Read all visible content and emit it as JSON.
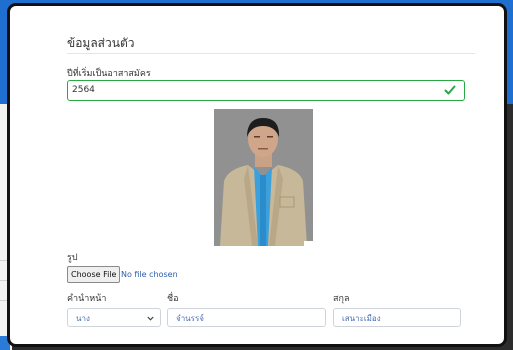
{
  "colors": {
    "accent": "#1f6fd0",
    "valid": "#28a745",
    "link": "#2a5db0"
  },
  "modal": {
    "title": "ข้อมูลส่วนตัว",
    "year_label": "ปีที่เริ่มเป็นอาสาสมัคร",
    "year_value": "2564",
    "photo_label": "รูป",
    "file_button": "Choose File",
    "file_status": "No file chosen",
    "prefix_label": "คำนำหน้า",
    "prefix_value": "นาง",
    "first_name_label": "ชื่อ",
    "first_name_value": "จำนรรจ์",
    "last_name_label": "สกุล",
    "last_name_value": "เสนาะเมือง"
  },
  "icons": {
    "valid": "check-icon",
    "dropdown": "chevron-down-icon"
  }
}
